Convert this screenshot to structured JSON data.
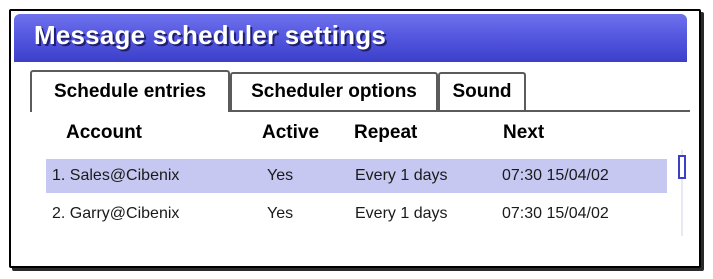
{
  "window": {
    "title": "Message scheduler settings"
  },
  "tabs": [
    {
      "label": "Schedule entries",
      "active": true
    },
    {
      "label": "Scheduler options",
      "active": false
    },
    {
      "label": "Sound",
      "active": false
    }
  ],
  "table": {
    "headers": {
      "account": "Account",
      "active": "Active",
      "repeat": "Repeat",
      "next": "Next"
    },
    "rows": [
      {
        "account": "1. Sales@Cibenix",
        "active": "Yes",
        "repeat": "Every 1 days",
        "next": "07:30 15/04/02",
        "selected": true
      },
      {
        "account": "2. Garry@Cibenix",
        "active": "Yes",
        "repeat": "Every 1 days",
        "next": "07:30 15/04/02",
        "selected": false
      }
    ]
  },
  "colors": {
    "title_bar": "#5558e0",
    "selection": "#c6c8f2",
    "scroll_thumb": "#3d3fc5"
  }
}
